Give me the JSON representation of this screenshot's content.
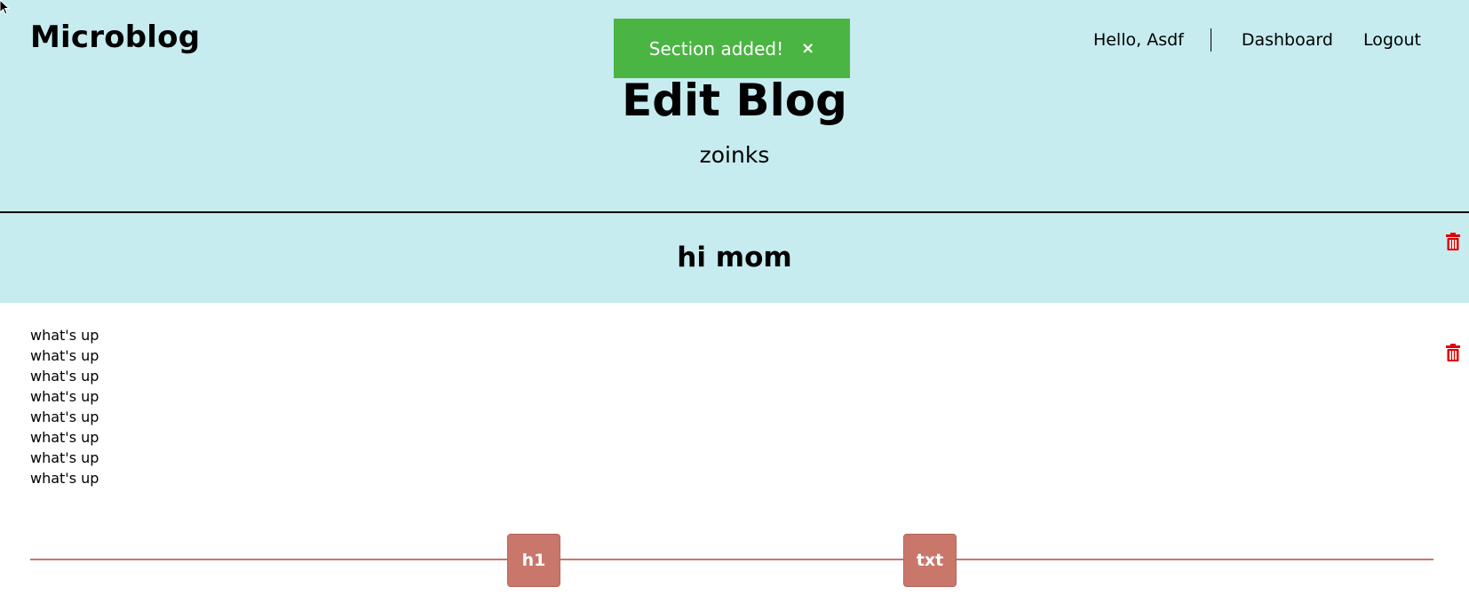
{
  "header": {
    "brand": "Microblog",
    "greeting": "Hello, Asdf",
    "nav_links": [
      "Dashboard",
      "Logout"
    ],
    "title": "Edit Blog",
    "subtitle": "zoinks"
  },
  "toast": {
    "message": "Section added!",
    "close_glyph": "×",
    "color": "#4bb543"
  },
  "sections": {
    "heading": {
      "text": "hi mom",
      "icon": "trash-icon"
    },
    "text": {
      "lines": [
        "what's up",
        "what's up",
        "what's up",
        "what's up",
        "what's up",
        "what's up",
        "what's up",
        "what's up"
      ],
      "icon": "trash-icon"
    }
  },
  "add_controls": {
    "h1_label": "h1",
    "txt_label": "txt"
  },
  "colors": {
    "header_bg": "#c6ecef",
    "accent": "#c9776b",
    "delete": "#e00000"
  }
}
